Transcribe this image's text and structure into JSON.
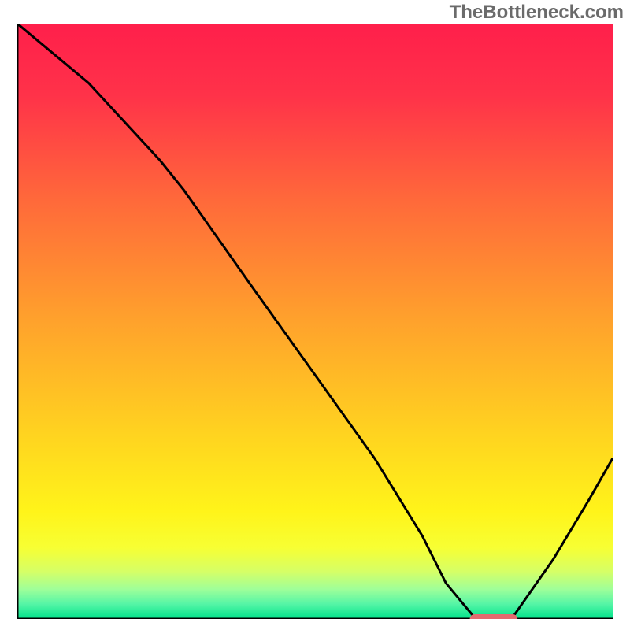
{
  "watermark": "TheBottleneck.com",
  "chart_data": {
    "type": "line",
    "title": "",
    "xlabel": "",
    "ylabel": "",
    "xlim": [
      0,
      100
    ],
    "ylim": [
      0,
      100
    ],
    "grid": false,
    "gradient_stops": [
      {
        "offset": 0,
        "color": "#ff1f4b"
      },
      {
        "offset": 0.12,
        "color": "#ff3249"
      },
      {
        "offset": 0.3,
        "color": "#ff6a3a"
      },
      {
        "offset": 0.5,
        "color": "#ffa22c"
      },
      {
        "offset": 0.7,
        "color": "#ffd61f"
      },
      {
        "offset": 0.82,
        "color": "#fff41a"
      },
      {
        "offset": 0.88,
        "color": "#f7ff33"
      },
      {
        "offset": 0.92,
        "color": "#d6ff66"
      },
      {
        "offset": 0.95,
        "color": "#9fff99"
      },
      {
        "offset": 0.975,
        "color": "#55f5a6"
      },
      {
        "offset": 1.0,
        "color": "#00e38b"
      }
    ],
    "series": [
      {
        "name": "bottleneck-curve",
        "x": [
          0,
          12,
          24,
          28,
          40,
          50,
          60,
          68,
          72,
          77,
          83,
          90,
          96,
          100
        ],
        "y": [
          100,
          90,
          77,
          72,
          55,
          41,
          27,
          14,
          6,
          0,
          0,
          10,
          20,
          27
        ]
      }
    ],
    "marker": {
      "name": "optimal-range",
      "x_start": 76,
      "x_end": 84,
      "y": 0,
      "color": "#e46a6f"
    }
  }
}
